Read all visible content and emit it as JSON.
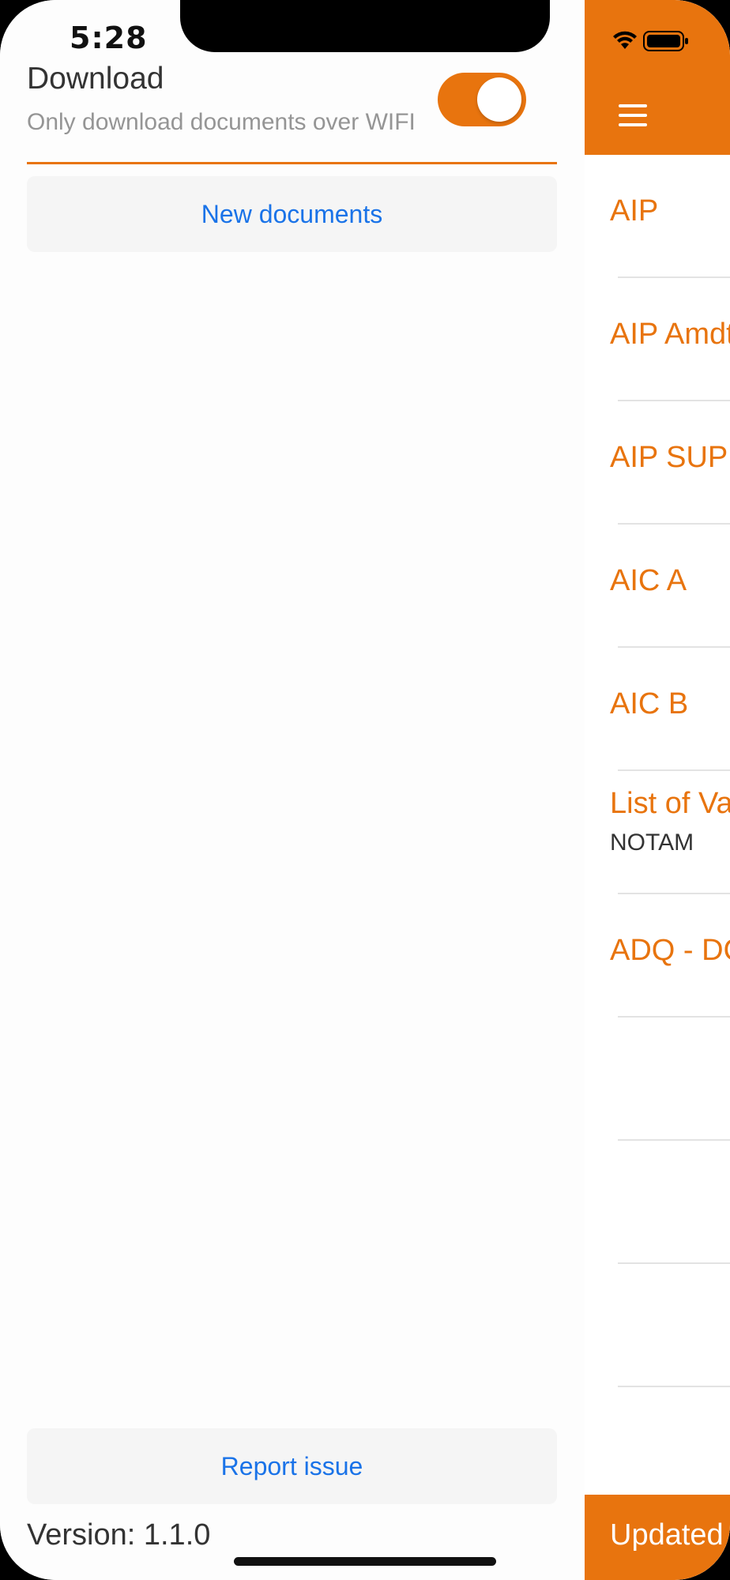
{
  "status_bar": {
    "time": "5:28"
  },
  "drawer": {
    "download_title": "Download",
    "download_subtitle": "Only download documents over WIFI",
    "wifi_only_toggle_on": true,
    "new_documents_label": "New documents",
    "report_issue_label": "Report issue",
    "version_text": "Version: 1.1.0"
  },
  "main": {
    "menu_icon": "hamburger-icon",
    "items": [
      {
        "label": "AIP",
        "sub": ""
      },
      {
        "label": "AIP Amdt",
        "sub": ""
      },
      {
        "label": "AIP SUP",
        "sub": ""
      },
      {
        "label": "AIC A",
        "sub": ""
      },
      {
        "label": "AIC B",
        "sub": ""
      },
      {
        "label": "List of Va",
        "sub": "NOTAM"
      },
      {
        "label": "ADQ - DC",
        "sub": ""
      },
      {
        "label": "",
        "sub": ""
      },
      {
        "label": "",
        "sub": ""
      },
      {
        "label": "",
        "sub": ""
      }
    ],
    "updated_label": "Updated"
  },
  "colors": {
    "accent": "#e8740e",
    "link": "#1a73e8"
  }
}
